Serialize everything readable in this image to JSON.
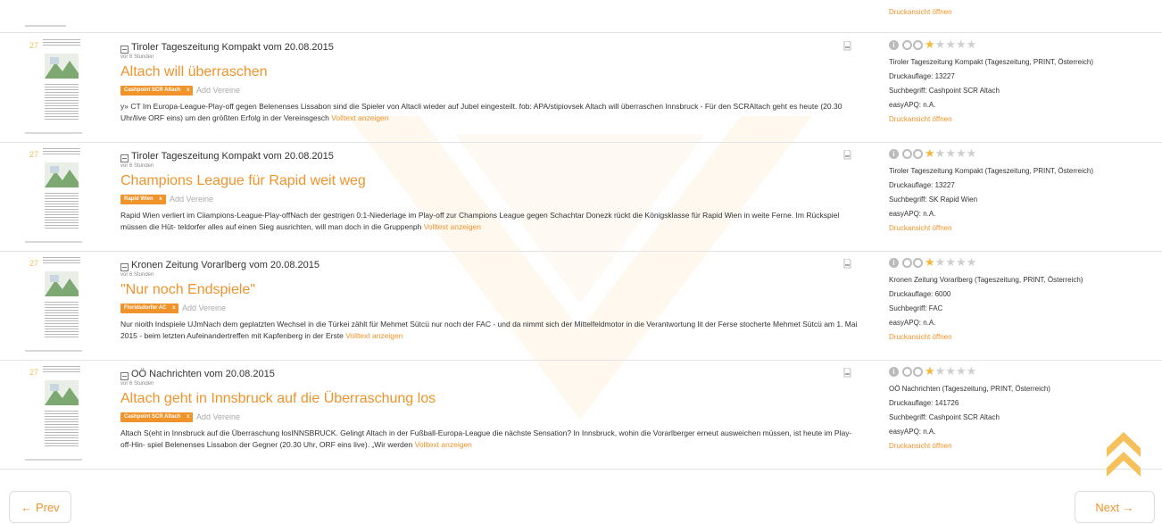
{
  "top": {
    "print_link": "Druckansicht öffnen"
  },
  "articles": [
    {
      "rank": "27",
      "source": "Tiroler Tageszeitung Kompakt vom 20.08.2015",
      "age": "vor 6 Stunden",
      "title": "Altach will überraschen",
      "tag": "Cashpoint SCR Altach",
      "tag_remove": "x",
      "add_vereine": "Add Vereine",
      "snippet": "y» CT Im Europa-League-Play-off gegen Belenenses Lissabon sind die Spieler von Altacli wieder auf Jubel eingesteilt. fob: APA/stipiovsek Altach will überraschen Innsbruck - Für den SCRAltach geht es heute (20.30 Uhr/live ORF eins) um den größten Erfolg in der Vereinsgesch",
      "fulltext_link": "Volltext anzeigen",
      "rating": {
        "info": "i",
        "stars_filled": 1,
        "stars_total": 5
      },
      "medium": "Tiroler Tageszeitung Kompakt (Tageszeitung, PRINT, Österreich)",
      "druckauflage": "Druckauflage: 13227",
      "suchbegriff": "Suchbegriff: Cashpoint SCR Altach",
      "easyapq": "easyAPQ: n.A.",
      "print_link": "Druckansicht öffnen"
    },
    {
      "rank": "27",
      "source": "Tiroler Tageszeitung Kompakt vom 20.08.2015",
      "age": "vor 6 Stunden",
      "title": "Champions League für Rapid weit weg",
      "tag": "Rapid Wien",
      "tag_remove": "x",
      "add_vereine": "Add Vereine",
      "snippet": "Rapid Wien verliert im Ciiampions-League-Play-offNach der gestrigen 0:1-Niederlage im Play-off zur Champions League gegen Schachtar Donezk rückt die Königsklasse für Rapid Wien in weite Ferne. Im Rückspiel müssen die Hüt- teldorfer alles auf einen Sieg ausrichten, will man doch in die Gruppenph",
      "fulltext_link": "Volltext anzeigen",
      "rating": {
        "info": "i",
        "stars_filled": 1,
        "stars_total": 5
      },
      "medium": "Tiroler Tageszeitung Kompakt (Tageszeitung, PRINT, Österreich)",
      "druckauflage": "Druckauflage: 13227",
      "suchbegriff": "Suchbegriff: SK Rapid Wien",
      "easyapq": "easyAPQ: n.A.",
      "print_link": "Druckansicht öffnen"
    },
    {
      "rank": "27",
      "source": "Kronen Zeitung Vorarlberg vom 20.08.2015",
      "age": "vor 6 Stunden",
      "title": "\"Nur noch Endspiele\"",
      "tag": "Floridsdorfer AC",
      "tag_remove": "x",
      "add_vereine": "Add Vereine",
      "snippet": "Nur nioith Indspiele UJmNach dem geplatzten Wechsel in die Türkei zählt für Mehmet Sütcü nur noch der FAC - und da nimmt sich der Mittelfeldmotor in die Verantwortung lit der Ferse stocherte Mehmet Sütcü am 1. Mai 2015 - beim letzten Aufeinandertreffen mit Kapfenberg in der Erste",
      "fulltext_link": "Volltext anzeigen",
      "rating": {
        "info": "i",
        "stars_filled": 1,
        "stars_total": 5
      },
      "medium": "Kronen Zeitung Vorarlberg (Tageszeitung, PRINT, Österreich)",
      "druckauflage": "Druckauflage: 6000",
      "suchbegriff": "Suchbegriff: FAC",
      "easyapq": "easyAPQ: n.A.",
      "print_link": "Druckansicht öffnen"
    },
    {
      "rank": "27",
      "source": "OÖ Nachrichten vom 20.08.2015",
      "age": "vor 6 Stunden",
      "title": "Altach geht in Innsbruck auf die Überraschung los",
      "tag": "Cashpoint SCR Altach",
      "tag_remove": "x",
      "add_vereine": "Add Vereine",
      "snippet": "Altach S(eht in Innsbruck auf die Überraschung losINNSBRUCK. Gelingt Altach in der Fußball-Europa-League die nächste Sensation? In Innsbruck, wohin die Vorarlberger erneut ausweichen müssen, ist heute im Play-off-Hin- spiel Belenenses Lissabon der Gegner (20.30 Uhr, ORF eins live). „Wir werden",
      "fulltext_link": "Volltext anzeigen",
      "rating": {
        "info": "i",
        "stars_filled": 1,
        "stars_total": 5
      },
      "medium": "OÖ Nachrichten (Tageszeitung, PRINT, Österreich)",
      "druckauflage": "Druckauflage: 141726",
      "suchbegriff": "Suchbegriff: Cashpoint SCR Altach",
      "easyapq": "easyAPQ: n.A.",
      "print_link": "Druckansicht öffnen"
    }
  ],
  "pagination": {
    "prev": "← Prev",
    "next": "Next →"
  },
  "colors": {
    "accent": "#f0932b",
    "star": "#f6b73c",
    "border": "#e3e3e3"
  },
  "icons": {
    "source": "newspaper-icon",
    "pdf": "pdf-icon",
    "scroll_top": "chevron-up-icon"
  }
}
